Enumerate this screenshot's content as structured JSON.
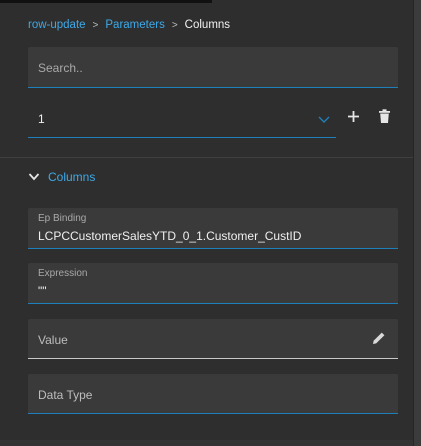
{
  "breadcrumb": {
    "items": [
      "row-update",
      "Parameters"
    ],
    "separator": ">",
    "current": "Columns"
  },
  "search": {
    "placeholder": "Search.."
  },
  "selector": {
    "value": "1"
  },
  "section": {
    "title": "Columns"
  },
  "fields": {
    "ep_binding": {
      "label": "Ep Binding",
      "value": "LCPCCustomerSalesYTD_0_1.Customer_CustID"
    },
    "expression": {
      "label": "Expression",
      "value": "\"\""
    },
    "value": {
      "placeholder": "Value"
    },
    "data_type": {
      "placeholder": "Data Type"
    }
  },
  "icons": {
    "dropdown": "chevron-down-icon",
    "add": "plus-icon",
    "delete": "trash-icon",
    "collapse": "chevron-down-icon",
    "edit": "pencil-icon"
  },
  "colors": {
    "accent": "#3ea9e8",
    "background": "#2e2e2e",
    "field_bg": "#3a3a3a"
  }
}
